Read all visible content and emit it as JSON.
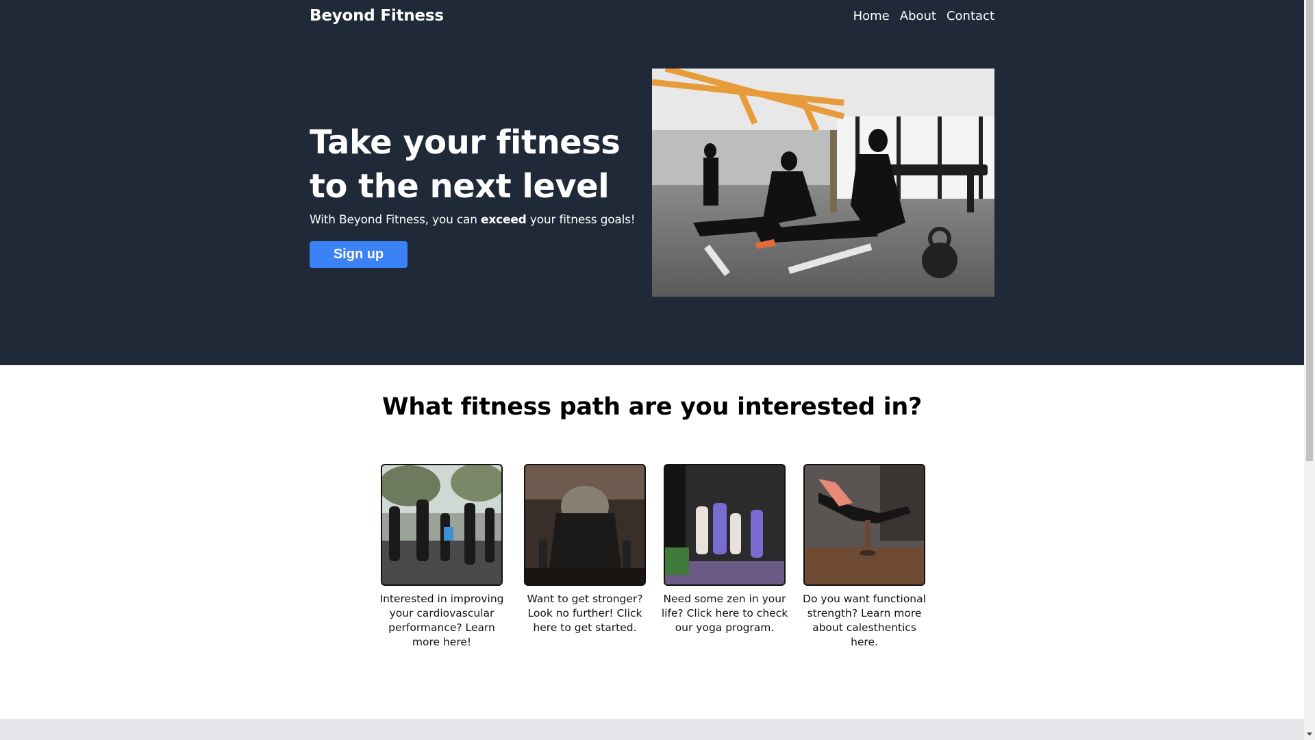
{
  "header": {
    "brand": "Beyond Fitness",
    "nav": [
      "Home",
      "About",
      "Contact"
    ]
  },
  "hero": {
    "title": "Take your fitness to the next level",
    "subtitle_before": "With Beyond Fitness, you can ",
    "subtitle_bold": "exceed",
    "subtitle_after": " your fitness goals!",
    "signup_label": "Sign up",
    "image_icon": "gym-photo"
  },
  "paths": {
    "title": "What fitness path are you interested in?",
    "cards": [
      {
        "icon": "running-group-photo",
        "text": "Interested in improving your cardiovascular performance? Learn more here!"
      },
      {
        "icon": "strength-training-photo",
        "text": "Want to get stronger? Look no further! Click here to get started."
      },
      {
        "icon": "yoga-class-photo",
        "text": "Need some zen in your life? Click here to check our yoga program."
      },
      {
        "icon": "calisthenics-photo",
        "text": "Do you want functional strength? Learn more about calesthentics here."
      }
    ]
  },
  "colors": {
    "hero_bg": "#1f2937",
    "accent": "#3b82f6",
    "footer_bg": "#e5e7eb"
  }
}
